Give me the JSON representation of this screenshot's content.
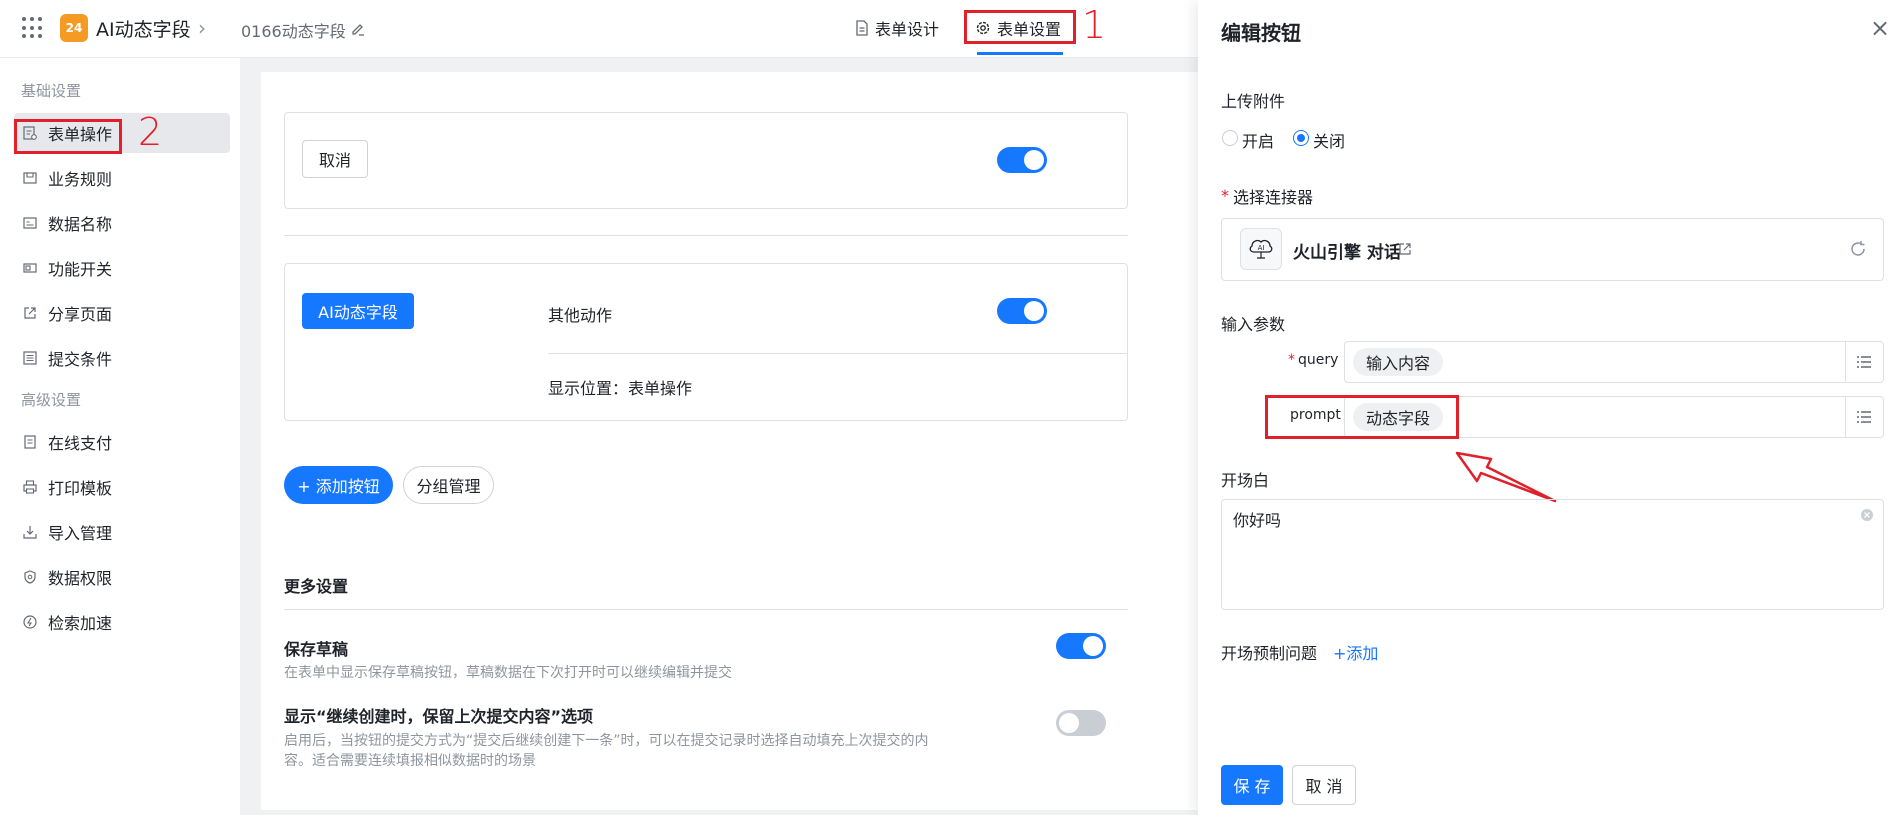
{
  "header": {
    "app_logo_text": "24",
    "app_name": "AI动态字段",
    "form_name": "0166动态字段",
    "tabs": [
      {
        "label": "表单设计"
      },
      {
        "label": "表单设置"
      }
    ],
    "annotation_1": "1"
  },
  "sidebar": {
    "group_basic": "基础设置",
    "group_advanced": "高级设置",
    "items": [
      {
        "label": "表单操作",
        "icon": "form-operation-icon"
      },
      {
        "label": "业务规则",
        "icon": "business-rule-icon"
      },
      {
        "label": "数据名称",
        "icon": "data-name-icon"
      },
      {
        "label": "功能开关",
        "icon": "toggle-icon"
      },
      {
        "label": "分享页面",
        "icon": "share-icon"
      },
      {
        "label": "提交条件",
        "icon": "list-icon"
      },
      {
        "label": "在线支付",
        "icon": "payment-icon"
      },
      {
        "label": "打印模板",
        "icon": "print-icon"
      },
      {
        "label": "导入管理",
        "icon": "import-icon"
      },
      {
        "label": "数据权限",
        "icon": "shield-icon"
      },
      {
        "label": "检索加速",
        "icon": "speed-icon"
      }
    ],
    "annotation_2": "2"
  },
  "main": {
    "cancel_button": "取消",
    "ai_field_tag": "AI动态字段",
    "other_actions_label": "其他动作",
    "display_position": "显示位置：表单操作",
    "add_button": "+ 添加按钮",
    "group_manage_button": "分组管理",
    "more_settings_title": "更多设置",
    "save_draft_title": "保存草稿",
    "save_draft_desc": "在表单中显示保存草稿按钮，草稿数据在下次打开时可以继续编辑并提交",
    "continue_create_title": "显示“继续创建时，保留上次提交内容”选项",
    "continue_create_desc_1": "启用后，当按钮的提交方式为“提交后继续创建下一条”时，可以在提交记录时选择自动填充上次提交的内",
    "continue_create_desc_2": "容。适合需要连续填报相似数据时的场景"
  },
  "panel": {
    "title": "编辑按钮",
    "upload_label": "上传附件",
    "radio_on": "开启",
    "radio_off": "关闭",
    "radio_selected": "关闭",
    "connector_label": "选择连接器",
    "required_mark": "*",
    "connector_name": "火山引擎 对话",
    "input_params_label": "输入参数",
    "params": [
      {
        "name": "query",
        "required": true,
        "value": "输入内容"
      },
      {
        "name": "prompt",
        "required": false,
        "value": "动态字段"
      }
    ],
    "opening_label": "开场白",
    "opening_text": "你好吗",
    "preset_questions_label": "开场预制问题",
    "add_link": "+添加",
    "save_button": "保 存",
    "cancel_button": "取 消"
  },
  "colors": {
    "primary": "#1677ff",
    "annotation_red": "#e0202a",
    "logo_orange": "#f59a23"
  }
}
